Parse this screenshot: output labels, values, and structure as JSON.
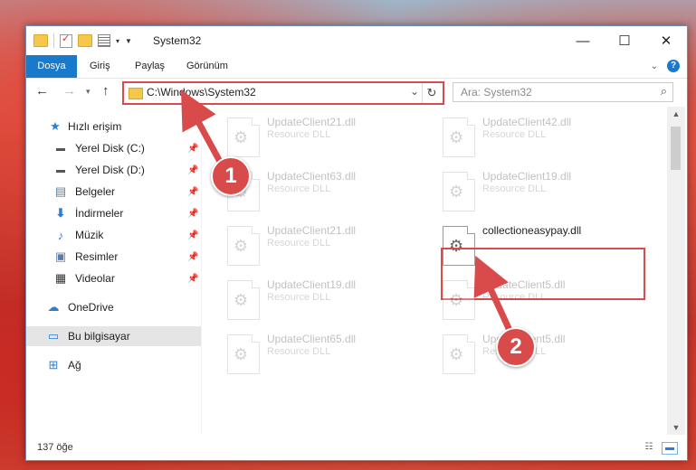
{
  "window": {
    "title": "System32",
    "controls": {
      "minimize": "—",
      "maximize": "☐",
      "close": "✕"
    }
  },
  "ribbon": {
    "tabs": [
      "Dosya",
      "Giriş",
      "Paylaş",
      "Görünüm"
    ]
  },
  "address_bar": {
    "path": "C:\\Windows\\System32",
    "search_placeholder": "Ara: System32"
  },
  "nav_pane": {
    "items": [
      {
        "label": "Hızlı erişim",
        "icon": "star-icon"
      },
      {
        "label": "Yerel Disk (C:)",
        "icon": "drive-icon",
        "pinned": true
      },
      {
        "label": "Yerel Disk (D:)",
        "icon": "drive-icon",
        "pinned": true
      },
      {
        "label": "Belgeler",
        "icon": "documents-icon",
        "pinned": true
      },
      {
        "label": "İndirmeler",
        "icon": "download-icon",
        "pinned": true
      },
      {
        "label": "Müzik",
        "icon": "music-icon",
        "pinned": true
      },
      {
        "label": "Resimler",
        "icon": "pictures-icon",
        "pinned": true
      },
      {
        "label": "Videolar",
        "icon": "videos-icon",
        "pinned": true
      },
      {
        "label": "OneDrive",
        "icon": "cloud-icon"
      },
      {
        "label": "Bu bilgisayar",
        "icon": "computer-icon",
        "selected": true
      },
      {
        "label": "Ağ",
        "icon": "network-icon"
      }
    ]
  },
  "files": [
    {
      "name": "UpdateClient21.dll",
      "type": "Resource DLL"
    },
    {
      "name": "UpdateClient42.dll",
      "type": "Resource DLL"
    },
    {
      "name": "UpdateClient63.dll",
      "type": "Resource DLL"
    },
    {
      "name": "UpdateClient19.dll",
      "type": "Resource DLL"
    },
    {
      "name": "UpdateClient21.dll",
      "type": "Resource DLL"
    },
    {
      "name": "collectioneasypay.dll",
      "type": ""
    },
    {
      "name": "UpdateClient19.dll",
      "type": "Resource DLL"
    },
    {
      "name": "UpdateClient5.dll",
      "type": "Resource DLL"
    },
    {
      "name": "UpdateClient65.dll",
      "type": "Resource DLL"
    },
    {
      "name": "UpdateClient5.dll",
      "type": "Resource DLL"
    }
  ],
  "status": {
    "item_count": "137 öğe"
  },
  "annotations": {
    "step1": "1",
    "step2": "2",
    "color": "#d94a4a"
  }
}
